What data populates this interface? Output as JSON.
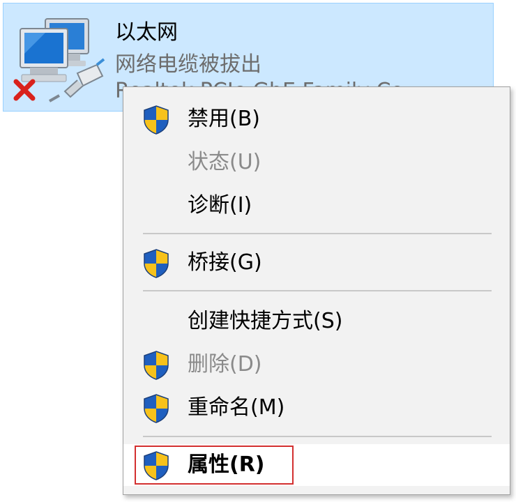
{
  "adapter": {
    "name": "以太网",
    "status": "网络电缆被拔出",
    "device": "Realtek PCIe GbE Family Co",
    "icon": "network-adapter-icon",
    "error_icon": "red-x-icon"
  },
  "menu": {
    "items": [
      {
        "label": "禁用(B)",
        "shield": true,
        "disabled": false
      },
      {
        "label": "状态(U)",
        "shield": false,
        "disabled": true
      },
      {
        "label": "诊断(I)",
        "shield": false,
        "disabled": false
      },
      {
        "label": "桥接(G)",
        "shield": true,
        "disabled": false
      },
      {
        "label": "创建快捷方式(S)",
        "shield": false,
        "disabled": false
      },
      {
        "label": "删除(D)",
        "shield": true,
        "disabled": true
      },
      {
        "label": "重命名(M)",
        "shield": true,
        "disabled": false
      },
      {
        "label": "属性(R)",
        "shield": true,
        "disabled": false,
        "bold": true,
        "highlighted": true
      }
    ]
  },
  "colors": {
    "selection_bg": "#cce8ff",
    "selection_border": "#99d1ff",
    "menu_bg": "#f2f2f2",
    "disabled_text": "#8a8a8a",
    "highlight_box": "#d32f2f",
    "shield_blue": "#1f5fbf",
    "shield_yellow": "#f7c21b"
  }
}
